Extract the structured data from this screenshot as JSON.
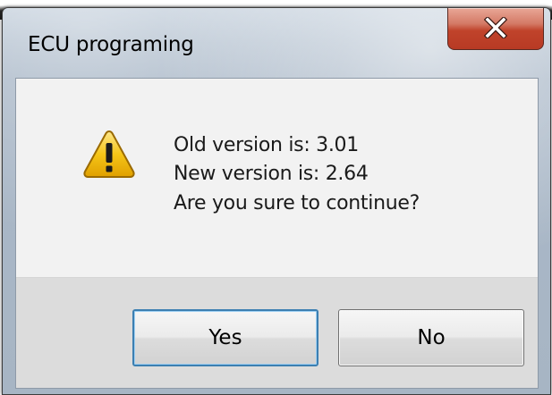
{
  "window": {
    "title": "ECU programing",
    "close_icon": "close-icon"
  },
  "dialog": {
    "icon": "warning-icon",
    "message_lines": [
      "Old version is: 3.01",
      "New version is: 2.64",
      "Are you sure to continue?"
    ]
  },
  "buttons": {
    "yes_label": "Yes",
    "no_label": "No"
  },
  "colors": {
    "close_button": "#c0432b",
    "warning_yellow": "#f0c020",
    "default_button_border": "#3c7fb1"
  }
}
